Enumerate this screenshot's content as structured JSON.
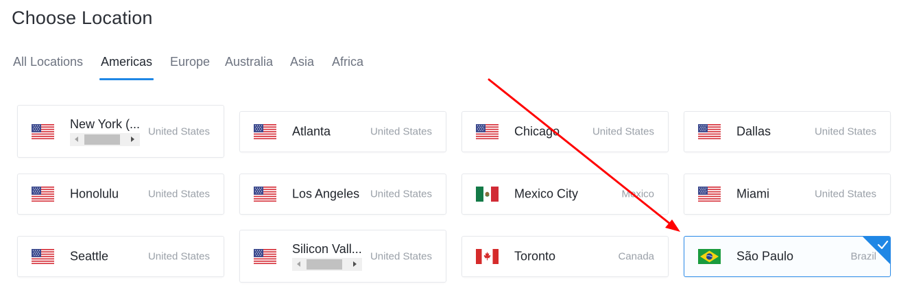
{
  "page": {
    "title": "Choose Location"
  },
  "tabs": [
    {
      "label": "All Locations",
      "active": false
    },
    {
      "label": "Americas",
      "active": true
    },
    {
      "label": "Europe",
      "active": false
    },
    {
      "label": "Australia",
      "active": false
    },
    {
      "label": "Asia",
      "active": false
    },
    {
      "label": "Africa",
      "active": false
    }
  ],
  "colors": {
    "accent": "#1f87e5",
    "annotation_arrow": "#ff0000"
  },
  "locations": [
    {
      "city": "New York (...",
      "country": "United States",
      "flag": "us-flag-icon",
      "has_scrollbar": true
    },
    {
      "city": "Atlanta",
      "country": "United States",
      "flag": "us-flag-icon"
    },
    {
      "city": "Chicago",
      "country": "United States",
      "flag": "us-flag-icon"
    },
    {
      "city": "Dallas",
      "country": "United States",
      "flag": "us-flag-icon"
    },
    {
      "city": "Honolulu",
      "country": "United States",
      "flag": "us-flag-icon"
    },
    {
      "city": "Los Angeles",
      "country": "United States",
      "flag": "us-flag-icon"
    },
    {
      "city": "Mexico City",
      "country": "Mexico",
      "flag": "mexico-flag-icon"
    },
    {
      "city": "Miami",
      "country": "United States",
      "flag": "us-flag-icon"
    },
    {
      "city": "Seattle",
      "country": "United States",
      "flag": "us-flag-icon"
    },
    {
      "city": "Silicon Vall...",
      "country": "United States",
      "flag": "us-flag-icon",
      "has_scrollbar": true
    },
    {
      "city": "Toronto",
      "country": "Canada",
      "flag": "canada-flag-icon"
    },
    {
      "city": "São Paulo",
      "country": "Brazil",
      "flag": "brazil-flag-icon",
      "selected": true
    }
  ]
}
